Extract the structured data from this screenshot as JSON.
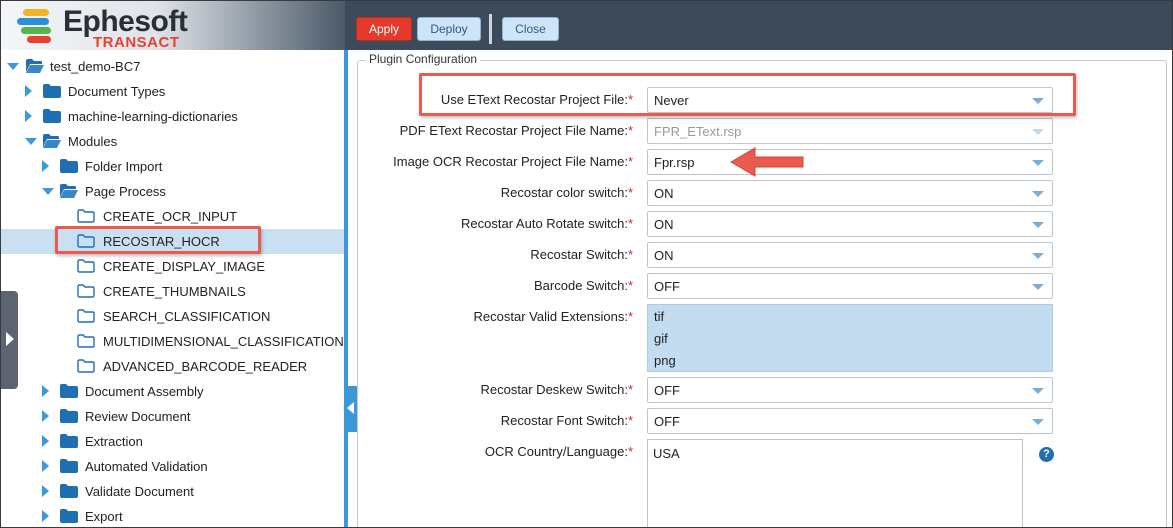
{
  "logo": {
    "name": "Ephesoft",
    "sub": "TRANSACT"
  },
  "toolbar": {
    "apply": "Apply",
    "deploy": "Deploy",
    "close": "Close"
  },
  "tree": {
    "root": "test_demo-BC7",
    "items": [
      {
        "label": "test_demo-BC7",
        "level": 0,
        "caret": "down",
        "icon": "folder-open"
      },
      {
        "label": "Document Types",
        "level": 1,
        "caret": "right",
        "icon": "folder"
      },
      {
        "label": "machine-learning-dictionaries",
        "level": 1,
        "caret": "right",
        "icon": "folder"
      },
      {
        "label": "Modules",
        "level": 1,
        "caret": "down",
        "icon": "folder-open"
      },
      {
        "label": "Folder Import",
        "level": 2,
        "caret": "right",
        "icon": "folder"
      },
      {
        "label": "Page Process",
        "level": 2,
        "caret": "down",
        "icon": "folder-open"
      },
      {
        "label": "CREATE_OCR_INPUT",
        "level": 3,
        "caret": "none",
        "icon": "folder-outline"
      },
      {
        "label": "RECOSTAR_HOCR",
        "level": 3,
        "caret": "none",
        "icon": "folder-outline",
        "selected": true
      },
      {
        "label": "CREATE_DISPLAY_IMAGE",
        "level": 3,
        "caret": "none",
        "icon": "folder-outline"
      },
      {
        "label": "CREATE_THUMBNAILS",
        "level": 3,
        "caret": "none",
        "icon": "folder-outline"
      },
      {
        "label": "SEARCH_CLASSIFICATION",
        "level": 3,
        "caret": "none",
        "icon": "folder-outline"
      },
      {
        "label": "MULTIDIMENSIONAL_CLASSIFICATION",
        "level": 3,
        "caret": "none",
        "icon": "folder-outline"
      },
      {
        "label": "ADVANCED_BARCODE_READER",
        "level": 3,
        "caret": "none",
        "icon": "folder-outline"
      },
      {
        "label": "Document Assembly",
        "level": 2,
        "caret": "right",
        "icon": "folder"
      },
      {
        "label": "Review Document",
        "level": 2,
        "caret": "right",
        "icon": "folder"
      },
      {
        "label": "Extraction",
        "level": 2,
        "caret": "right",
        "icon": "folder"
      },
      {
        "label": "Automated Validation",
        "level": 2,
        "caret": "right",
        "icon": "folder"
      },
      {
        "label": "Validate Document",
        "level": 2,
        "caret": "right",
        "icon": "folder"
      },
      {
        "label": "Export",
        "level": 2,
        "caret": "right",
        "icon": "folder"
      }
    ]
  },
  "config": {
    "legend": "Plugin Configuration",
    "required_mark": "*",
    "fields": {
      "etext_project_file": {
        "label": "Use EText Recostar Project File:",
        "value": "Never"
      },
      "pdf_etext_name": {
        "label": "PDF EText Recostar Project File Name:",
        "value": "FPR_EText.rsp"
      },
      "image_ocr_name": {
        "label": "Image OCR Recostar Project File Name:",
        "value": "Fpr.rsp"
      },
      "color_switch": {
        "label": "Recostar color switch:",
        "value": "ON"
      },
      "auto_rotate": {
        "label": "Recostar Auto Rotate switch:",
        "value": "ON"
      },
      "recostar_switch": {
        "label": "Recostar Switch:",
        "value": "ON"
      },
      "barcode_switch": {
        "label": "Barcode Switch:",
        "value": "OFF"
      },
      "valid_extensions": {
        "label": "Recostar Valid Extensions:",
        "options": [
          "tif",
          "gif",
          "png"
        ]
      },
      "deskew_switch": {
        "label": "Recostar Deskew Switch:",
        "value": "OFF"
      },
      "font_switch": {
        "label": "Recostar Font Switch:",
        "value": "OFF"
      },
      "ocr_language": {
        "label": "OCR Country/Language:",
        "value": "USA",
        "help": "?"
      }
    }
  },
  "colors": {
    "accent": "#3a9ad9",
    "annotation": "#e85b4d",
    "apply": "#e23a2b",
    "topbar": "#3c4a5a"
  }
}
